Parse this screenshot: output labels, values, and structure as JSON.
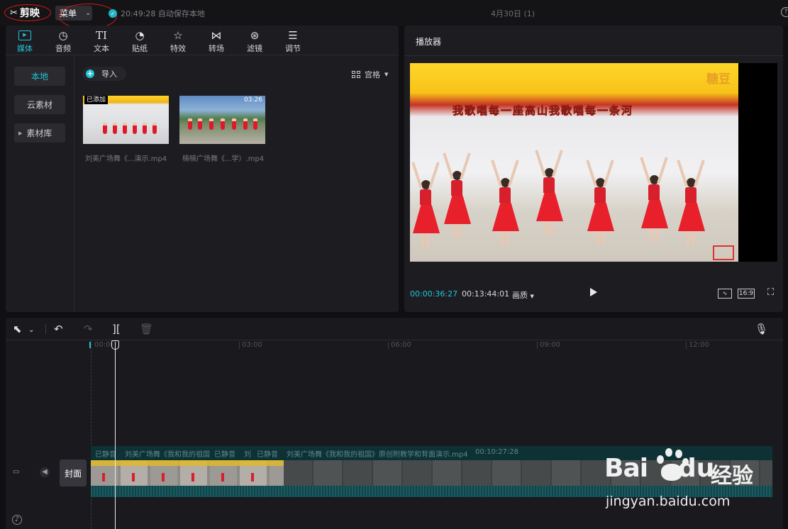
{
  "app": {
    "logo_text": "剪映",
    "menu_label": "菜单",
    "save_time": "20:49:28 自动保存本地",
    "project_title": "4月30日 (1)"
  },
  "media": {
    "tabs": [
      {
        "label": "媒体",
        "icon": "media-icon"
      },
      {
        "label": "音频",
        "icon": "audio-icon"
      },
      {
        "label": "文本",
        "icon": "text-icon",
        "glyph": "TI"
      },
      {
        "label": "贴纸",
        "icon": "sticker-icon"
      },
      {
        "label": "特效",
        "icon": "effects-icon"
      },
      {
        "label": "转场",
        "icon": "transition-icon"
      },
      {
        "label": "滤镜",
        "icon": "filter-icon"
      },
      {
        "label": "调节",
        "icon": "adjust-icon"
      }
    ],
    "sidebar": [
      {
        "label": "本地"
      },
      {
        "label": "云素材"
      },
      {
        "label": "素材库"
      }
    ],
    "import_label": "导入",
    "view_label": "宫格",
    "items": [
      {
        "name": "刘美广场舞《...演示.mp4",
        "badge": "已添加",
        "duration": ""
      },
      {
        "name": "楠楠广场舞《...学）.mp4",
        "badge": "",
        "duration": "03:26"
      }
    ]
  },
  "player": {
    "title": "播放器",
    "caption": "我歌唱每一座高山我歌唱每一条河",
    "watermark": "糖豆",
    "current_time": "00:00:36:27",
    "total_time": "00:13:44:01",
    "quality_label": "画质",
    "ratio_label": "16:9"
  },
  "timeline": {
    "ruler": [
      "00:00",
      "03:00",
      "06:00",
      "09:00",
      "12:00"
    ],
    "clip_labels": [
      "已静音",
      "刘美广场舞《我和我的祖国",
      "已静音",
      "刘",
      "已静音",
      "刘美广场舞《我和我的祖国》原创附教学和背面演示.mp4",
      "00:10:27:28"
    ],
    "cover_label": "封面"
  },
  "watermark": {
    "brand_a": "Bai",
    "brand_b": "du",
    "brand_c": "经验",
    "url": "jingyan.baidu.com"
  },
  "colors": {
    "accent": "#22c4d6",
    "annotation": "#d81818",
    "panel": "#1d1d21"
  }
}
